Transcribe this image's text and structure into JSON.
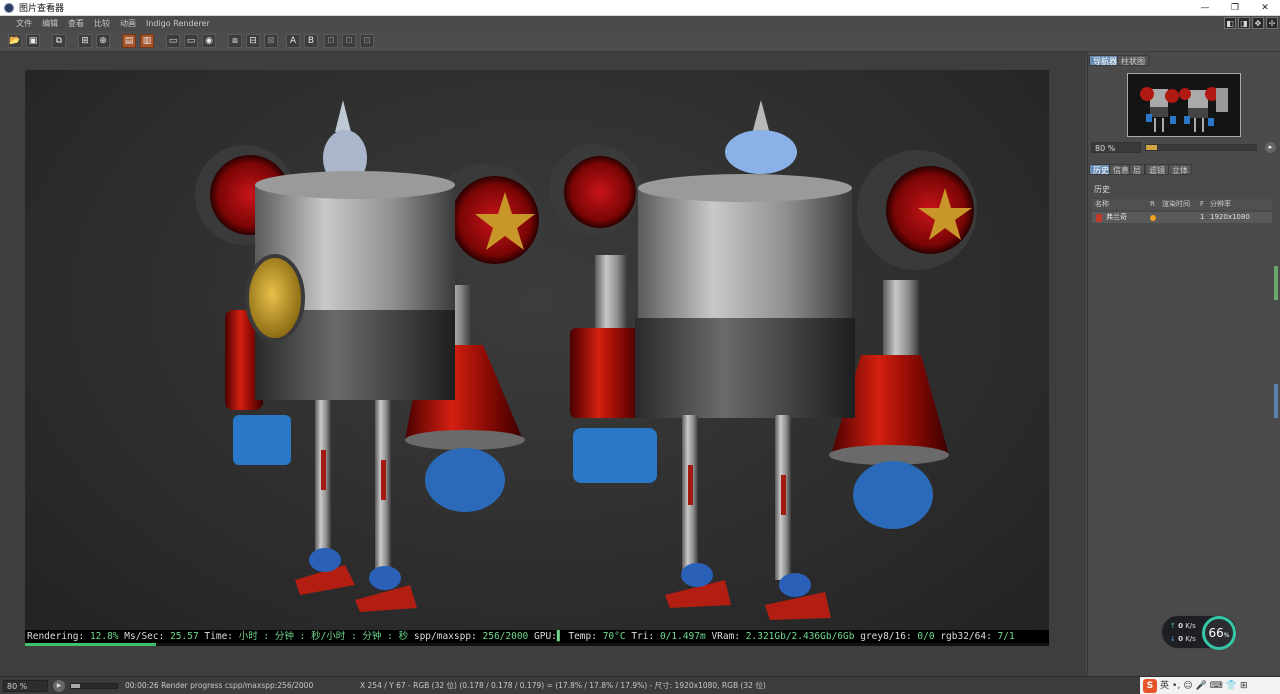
{
  "window": {
    "title": "图片查看器"
  },
  "menu": [
    "文件",
    "编辑",
    "查看",
    "比较",
    "动画",
    "Indigo Renderer"
  ],
  "render": {
    "label": "Rendering:",
    "percent": "12.8%",
    "ms_label": "Ms/Sec:",
    "ms_value": "25.57",
    "time_label": "Time:",
    "time_value": "小时 : 分钟 : 秒/小时 : 分钟 : 秒",
    "spp_label": "spp/maxspp:",
    "spp_value": "256/2000",
    "gpu_label": "GPU:",
    "temp_label": "Temp:",
    "temp_value": "70°C",
    "tri_label": "Tri:",
    "tri_value": "0/1.497m",
    "vram_label": "VRam:",
    "vram_value": "2.321Gb/2.436Gb/6Gb",
    "grey_label": "grey8/16:",
    "grey_value": "0/0",
    "rgb_label": "rgb32/64:",
    "rgb_value": "7/1",
    "progress": 0.128
  },
  "navigator": {
    "tabs": [
      "导航器",
      "柱状图"
    ],
    "zoom": "80 %",
    "zoom_level": 0.1
  },
  "panel": {
    "tabs": [
      "历史",
      "信息",
      "层",
      "滤镜",
      "立体"
    ],
    "section_title": "历史",
    "columns": [
      "名称",
      "R",
      "渲染时间",
      "F",
      "分辨率"
    ],
    "rows": [
      {
        "name": "弗兰奇",
        "frame": "1",
        "resolution": "1920x1080"
      }
    ]
  },
  "status": {
    "zoom": "80 %",
    "render_progress": "00:00:26 Render progress  cspp/maxspp:256/2000",
    "pixel_info": "X 254 / Y 67 - RGB (32 位) (0.178 / 0.178 / 0.179) = (17.8% / 17.8% / 17.9%) - 尺寸: 1920x1080, RGB (32 位)",
    "progress": 0.2
  },
  "widget": {
    "up": "0",
    "down": "0",
    "unit": "K/s",
    "percent": "66"
  },
  "tray": {
    "logo": "S",
    "lang": "英"
  },
  "colors": {
    "progress": "#3fc06f",
    "accent_tab": "#6a8cb3",
    "zoom_fill": "#d2a340"
  }
}
